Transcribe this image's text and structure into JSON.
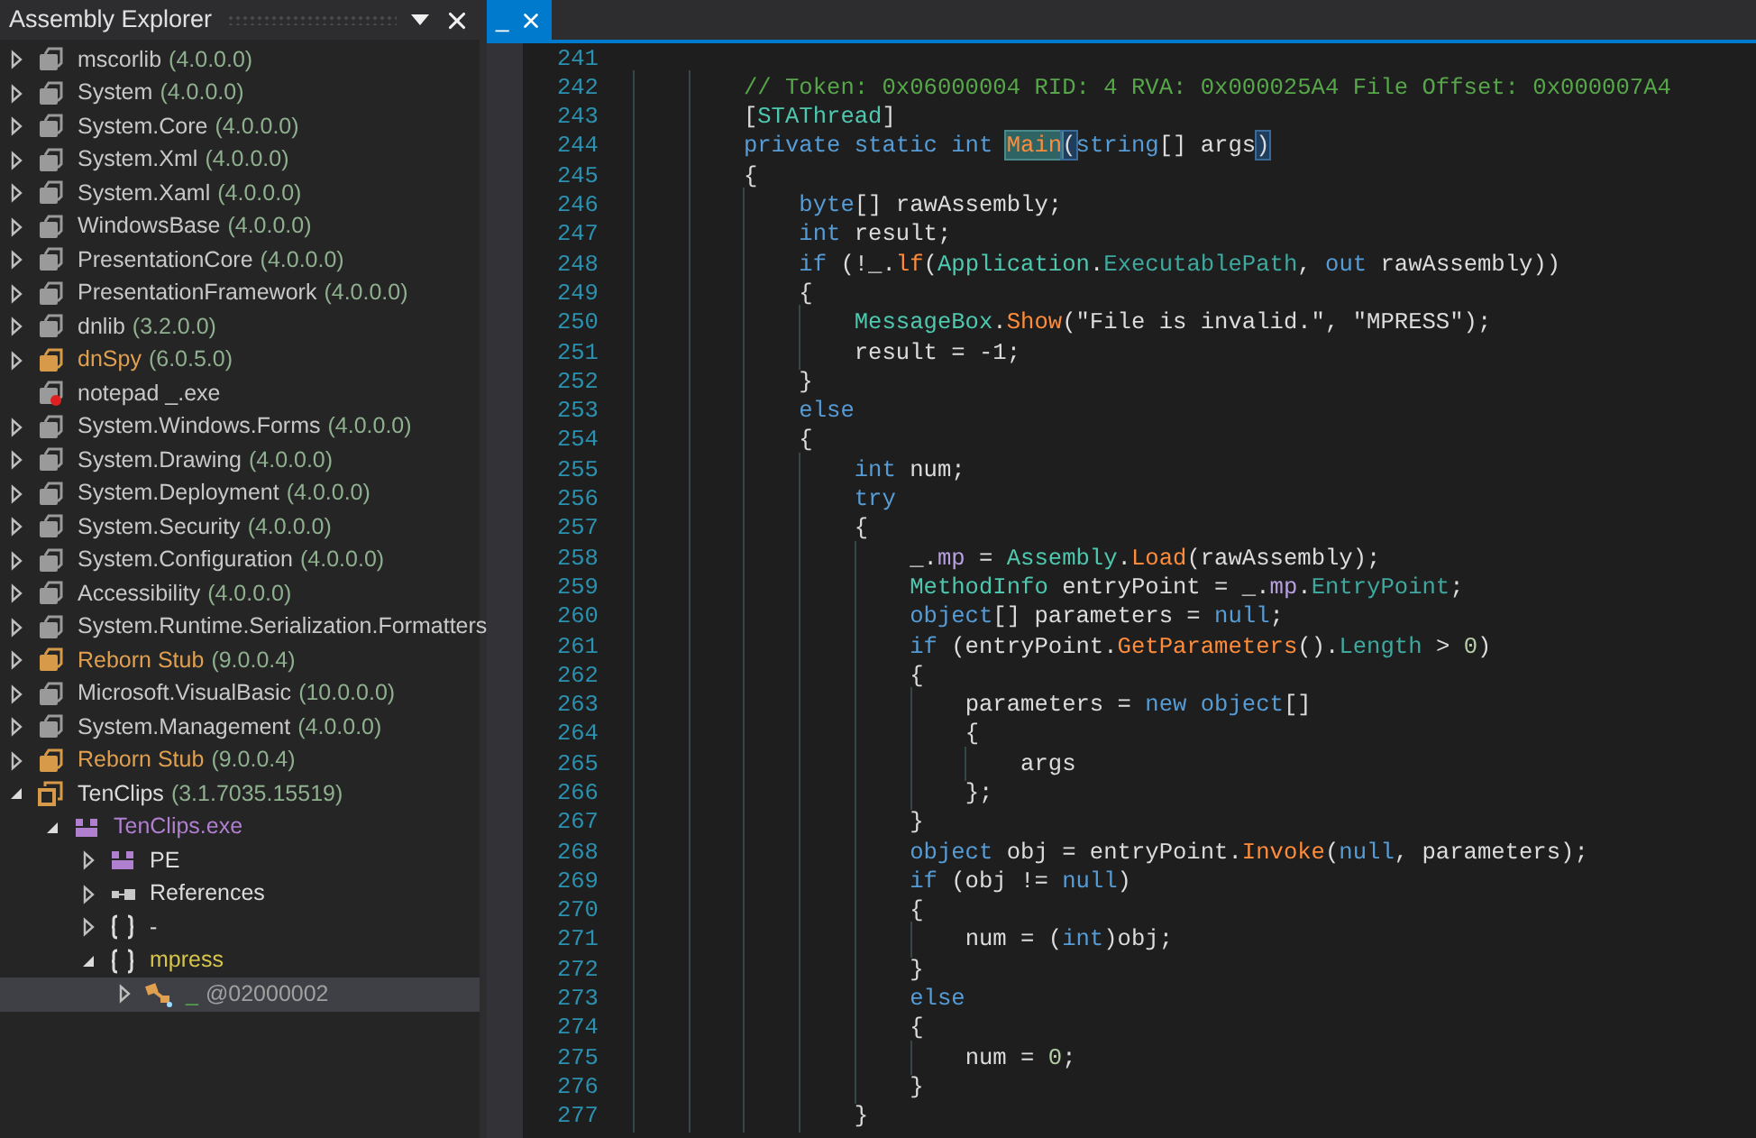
{
  "explorer": {
    "title": "Assembly Explorer",
    "tree": [
      {
        "name": "mscorlib",
        "version": "(4.0.0.0)",
        "kind": "dll",
        "expanded": false,
        "selected": false
      },
      {
        "name": "System",
        "version": "(4.0.0.0)",
        "kind": "dll",
        "expanded": false,
        "selected": false
      },
      {
        "name": "System.Core",
        "version": "(4.0.0.0)",
        "kind": "dll",
        "expanded": false,
        "selected": false
      },
      {
        "name": "System.Xml",
        "version": "(4.0.0.0)",
        "kind": "dll",
        "expanded": false,
        "selected": false
      },
      {
        "name": "System.Xaml",
        "version": "(4.0.0.0)",
        "kind": "dll",
        "expanded": false,
        "selected": false
      },
      {
        "name": "WindowsBase",
        "version": "(4.0.0.0)",
        "kind": "dll",
        "expanded": false,
        "selected": false
      },
      {
        "name": "PresentationCore",
        "version": "(4.0.0.0)",
        "kind": "dll",
        "expanded": false,
        "selected": false
      },
      {
        "name": "PresentationFramework",
        "version": "(4.0.0.0)",
        "kind": "dll",
        "expanded": false,
        "selected": false
      },
      {
        "name": "dnlib",
        "version": "(3.2.0.0)",
        "kind": "dll",
        "expanded": false,
        "selected": false
      },
      {
        "name": "dnSpy",
        "version": "(6.0.5.0)",
        "kind": "exe",
        "expanded": false,
        "selected": false
      },
      {
        "name": "notepad _.exe",
        "kind": "missing",
        "selected": false
      },
      {
        "name": "System.Windows.Forms",
        "version": "(4.0.0.0)",
        "kind": "dll",
        "expanded": false,
        "selected": false
      },
      {
        "name": "System.Drawing",
        "version": "(4.0.0.0)",
        "kind": "dll",
        "expanded": false,
        "selected": false
      },
      {
        "name": "System.Deployment",
        "version": "(4.0.0.0)",
        "kind": "dll",
        "expanded": false,
        "selected": false
      },
      {
        "name": "System.Security",
        "version": "(4.0.0.0)",
        "kind": "dll",
        "expanded": false,
        "selected": false
      },
      {
        "name": "System.Configuration",
        "version": "(4.0.0.0)",
        "kind": "dll",
        "expanded": false,
        "selected": false
      },
      {
        "name": "Accessibility",
        "version": "(4.0.0.0)",
        "kind": "dll",
        "expanded": false,
        "selected": false
      },
      {
        "name": "System.Runtime.Serialization.Formatters",
        "kind": "dll",
        "expanded": false,
        "selected": false
      },
      {
        "name": "Reborn Stub",
        "version": "(9.0.0.4)",
        "kind": "exe",
        "expanded": false,
        "selected": false
      },
      {
        "name": "Microsoft.VisualBasic",
        "version": "(10.0.0.0)",
        "kind": "dll",
        "expanded": false,
        "selected": false
      },
      {
        "name": "System.Management",
        "version": "(4.0.0.0)",
        "kind": "dll",
        "expanded": false,
        "selected": false
      },
      {
        "name": "Reborn Stub",
        "version": "(9.0.0.4)",
        "kind": "exe",
        "expanded": false,
        "selected": false
      },
      {
        "name": "TenClips",
        "version": "(3.1.7035.15519)",
        "kind": "assembly",
        "expanded": true,
        "selected": false,
        "children": [
          {
            "name": "TenClips.exe",
            "kind": "module",
            "expanded": true,
            "selected": false,
            "children": [
              {
                "name": "PE",
                "kind": "pe",
                "expanded": false,
                "selected": false
              },
              {
                "name": "References",
                "kind": "references",
                "expanded": false,
                "selected": false
              },
              {
                "name": "-",
                "kind": "namespace",
                "expanded": false,
                "selected": false
              },
              {
                "name": "mpress",
                "kind": "namespace-named",
                "expanded": true,
                "selected": false,
                "children": [
                  {
                    "name": "_",
                    "token": "@02000002",
                    "kind": "type",
                    "expanded": false,
                    "selected": true
                  }
                ]
              }
            ]
          }
        ]
      }
    ]
  },
  "editor": {
    "tabs": [
      {
        "title": "_",
        "selected": true
      }
    ],
    "lines": [
      {
        "number": "241"
      },
      {
        "number": "242",
        "tokens": [
          {
            "text": "        // Token: 0x06000004 RID: 4 RVA: 0x000025A4 File Offset: 0x000007A4",
            "kind": "comment"
          }
        ]
      },
      {
        "number": "243",
        "tokens": [
          {
            "text": "        [",
            "kind": "plain"
          },
          {
            "text": "STAThread",
            "kind": "type"
          },
          {
            "text": "]",
            "kind": "plain"
          }
        ]
      },
      {
        "number": "244",
        "tokens": [
          {
            "text": "        private static int ",
            "kind": "keyword"
          },
          {
            "text": "Main",
            "kind": "method",
            "highlighted": true
          },
          {
            "text": "(",
            "kind": "plain",
            "highlighted": true
          },
          {
            "text": "string",
            "kind": "keyword"
          },
          {
            "text": "[] args",
            "kind": "plain"
          },
          {
            "text": ")",
            "kind": "plain",
            "highlighted": true
          }
        ]
      },
      {
        "number": "245",
        "tokens": [
          {
            "text": "        {",
            "kind": "plain"
          }
        ]
      },
      {
        "number": "246",
        "tokens": [
          {
            "text": "            byte",
            "kind": "keyword"
          },
          {
            "text": "[] rawAssembly;",
            "kind": "plain"
          }
        ]
      },
      {
        "number": "247",
        "tokens": [
          {
            "text": "            int",
            "kind": "keyword"
          },
          {
            "text": " result;",
            "kind": "plain"
          }
        ]
      },
      {
        "number": "248",
        "tokens": [
          {
            "text": "            if",
            "kind": "keyword"
          },
          {
            "text": " (!_.",
            "kind": "plain"
          },
          {
            "text": "lf",
            "kind": "method"
          },
          {
            "text": "(",
            "kind": "plain"
          },
          {
            "text": "Application",
            "kind": "type"
          },
          {
            "text": ".",
            "kind": "plain"
          },
          {
            "text": "ExecutablePath",
            "kind": "property"
          },
          {
            "text": ", ",
            "kind": "plain"
          },
          {
            "text": "out",
            "kind": "keyword"
          },
          {
            "text": " rawAssembly))",
            "kind": "plain"
          }
        ]
      },
      {
        "number": "249",
        "tokens": [
          {
            "text": "            {",
            "kind": "plain"
          }
        ]
      },
      {
        "number": "250",
        "tokens": [
          {
            "text": "                MessageBox",
            "kind": "type"
          },
          {
            "text": ".",
            "kind": "plain"
          },
          {
            "text": "Show",
            "kind": "method"
          },
          {
            "text": "(\"File is invalid.\", \"MPRESS\");",
            "kind": "plain"
          }
        ]
      },
      {
        "number": "251",
        "tokens": [
          {
            "text": "                result = -1;",
            "kind": "plain"
          }
        ]
      },
      {
        "number": "252",
        "tokens": [
          {
            "text": "            }",
            "kind": "plain"
          }
        ]
      },
      {
        "number": "253",
        "tokens": [
          {
            "text": "            else",
            "kind": "keyword"
          }
        ]
      },
      {
        "number": "254",
        "tokens": [
          {
            "text": "            {",
            "kind": "plain"
          }
        ]
      },
      {
        "number": "255",
        "tokens": [
          {
            "text": "                int",
            "kind": "keyword"
          },
          {
            "text": " num;",
            "kind": "plain"
          }
        ]
      },
      {
        "number": "256",
        "tokens": [
          {
            "text": "                try",
            "kind": "keyword"
          }
        ]
      },
      {
        "number": "257",
        "tokens": [
          {
            "text": "                {",
            "kind": "plain"
          }
        ]
      },
      {
        "number": "258",
        "tokens": [
          {
            "text": "                    _.",
            "kind": "plain"
          },
          {
            "text": "mp",
            "kind": "field"
          },
          {
            "text": " = ",
            "kind": "plain"
          },
          {
            "text": "Assembly",
            "kind": "type"
          },
          {
            "text": ".",
            "kind": "plain"
          },
          {
            "text": "Load",
            "kind": "method"
          },
          {
            "text": "(rawAssembly);",
            "kind": "plain"
          }
        ]
      },
      {
        "number": "259",
        "tokens": [
          {
            "text": "                    MethodInfo",
            "kind": "type"
          },
          {
            "text": " entryPoint = _.",
            "kind": "plain"
          },
          {
            "text": "mp",
            "kind": "field"
          },
          {
            "text": ".",
            "kind": "plain"
          },
          {
            "text": "EntryPoint",
            "kind": "property"
          },
          {
            "text": ";",
            "kind": "plain"
          }
        ]
      },
      {
        "number": "260",
        "tokens": [
          {
            "text": "                    object",
            "kind": "keyword"
          },
          {
            "text": "[] parameters = ",
            "kind": "plain"
          },
          {
            "text": "null",
            "kind": "keyword"
          },
          {
            "text": ";",
            "kind": "plain"
          }
        ]
      },
      {
        "number": "261",
        "tokens": [
          {
            "text": "                    if",
            "kind": "keyword"
          },
          {
            "text": " (entryPoint.",
            "kind": "plain"
          },
          {
            "text": "GetParameters",
            "kind": "method"
          },
          {
            "text": "().",
            "kind": "plain"
          },
          {
            "text": "Length",
            "kind": "property"
          },
          {
            "text": " > ",
            "kind": "plain"
          },
          {
            "text": "0",
            "kind": "number"
          },
          {
            "text": ")",
            "kind": "plain"
          }
        ]
      },
      {
        "number": "262",
        "tokens": [
          {
            "text": "                    {",
            "kind": "plain"
          }
        ]
      },
      {
        "number": "263",
        "tokens": [
          {
            "text": "                        parameters = ",
            "kind": "plain"
          },
          {
            "text": "new object",
            "kind": "keyword"
          },
          {
            "text": "[]",
            "kind": "plain"
          }
        ]
      },
      {
        "number": "264",
        "tokens": [
          {
            "text": "                        {",
            "kind": "plain"
          }
        ]
      },
      {
        "number": "265",
        "tokens": [
          {
            "text": "                            args",
            "kind": "plain"
          }
        ]
      },
      {
        "number": "266",
        "tokens": [
          {
            "text": "                        };",
            "kind": "plain"
          }
        ]
      },
      {
        "number": "267",
        "tokens": [
          {
            "text": "                    }",
            "kind": "plain"
          }
        ]
      },
      {
        "number": "268",
        "tokens": [
          {
            "text": "                    object",
            "kind": "keyword"
          },
          {
            "text": " obj = entryPoint.",
            "kind": "plain"
          },
          {
            "text": "Invoke",
            "kind": "method"
          },
          {
            "text": "(",
            "kind": "plain"
          },
          {
            "text": "null",
            "kind": "keyword"
          },
          {
            "text": ", parameters);",
            "kind": "plain"
          }
        ]
      },
      {
        "number": "269",
        "tokens": [
          {
            "text": "                    if",
            "kind": "keyword"
          },
          {
            "text": " (obj != ",
            "kind": "plain"
          },
          {
            "text": "null",
            "kind": "keyword"
          },
          {
            "text": ")",
            "kind": "plain"
          }
        ]
      },
      {
        "number": "270",
        "tokens": [
          {
            "text": "                    {",
            "kind": "plain"
          }
        ]
      },
      {
        "number": "271",
        "tokens": [
          {
            "text": "                        num = (",
            "kind": "plain"
          },
          {
            "text": "int",
            "kind": "keyword"
          },
          {
            "text": ")obj;",
            "kind": "plain"
          }
        ]
      },
      {
        "number": "272",
        "tokens": [
          {
            "text": "                    }",
            "kind": "plain"
          }
        ]
      },
      {
        "number": "273",
        "tokens": [
          {
            "text": "                    else",
            "kind": "keyword"
          }
        ]
      },
      {
        "number": "274",
        "tokens": [
          {
            "text": "                    {",
            "kind": "plain"
          }
        ]
      },
      {
        "number": "275",
        "tokens": [
          {
            "text": "                        num = ",
            "kind": "plain"
          },
          {
            "text": "0",
            "kind": "number"
          },
          {
            "text": ";",
            "kind": "plain"
          }
        ]
      },
      {
        "number": "276",
        "tokens": [
          {
            "text": "                    }",
            "kind": "plain"
          }
        ]
      },
      {
        "number": "277",
        "tokens": [
          {
            "text": "                }",
            "kind": "plain"
          }
        ]
      }
    ]
  }
}
